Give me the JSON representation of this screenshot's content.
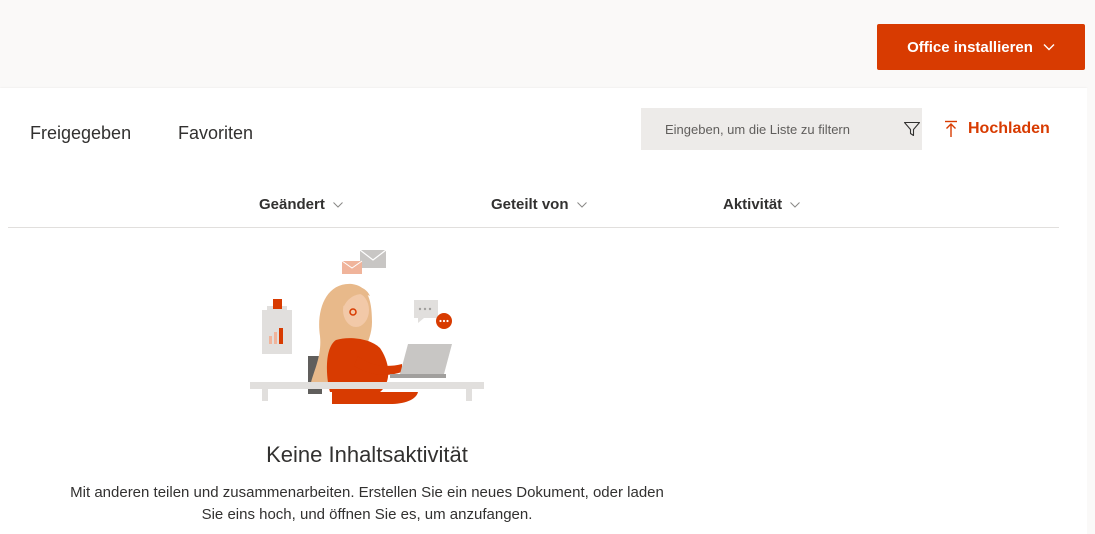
{
  "header": {
    "install_label": "Office installieren"
  },
  "tabs": {
    "shared": "Freigegeben",
    "favorites": "Favoriten"
  },
  "filter": {
    "placeholder": "Eingeben, um die Liste zu filtern"
  },
  "upload": {
    "label": "Hochladen"
  },
  "columns": {
    "modified": "Geändert",
    "shared_by": "Geteilt von",
    "activity": "Aktivität"
  },
  "empty_state": {
    "title": "Keine Inhaltsaktivität",
    "line1": "Mit anderen teilen und zusammenarbeiten. Erstellen Sie ein neues Dokument, oder laden",
    "line2": "Sie eins hoch, und öffnen Sie es, um anzufangen."
  },
  "colors": {
    "accent": "#d83b01",
    "background": "#faf9f8",
    "card": "#ffffff",
    "filter_bg": "#edebe9"
  },
  "icons": [
    "chevron-down-icon",
    "filter-icon",
    "upload-icon"
  ]
}
